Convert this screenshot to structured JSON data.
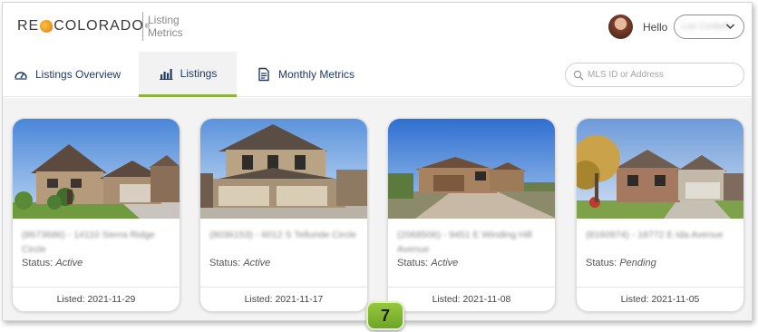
{
  "header": {
    "logo_re": "RE",
    "logo_word": "COLORADO",
    "logo_reg": "®",
    "app_name_line1": "Listing",
    "app_name_line2": "Metrics",
    "greeting": "Hello",
    "user_name": "Lori Corbett",
    "user_select_icon": "chevron-down-icon"
  },
  "nav": {
    "tabs": [
      {
        "label": "Listings Overview",
        "icon": "speedometer-icon",
        "active": false
      },
      {
        "label": "Listings",
        "icon": "bar-chart-icon",
        "active": true
      },
      {
        "label": "Monthly Metrics",
        "icon": "document-icon",
        "active": false
      }
    ],
    "search": {
      "placeholder": "MLS ID or Address",
      "icon": "search-icon"
    }
  },
  "listings": [
    {
      "address": "(8673686) - 14110 Sierra Ridge Circle",
      "status_label": "Status:",
      "status": "Active",
      "listed": "Listed: 2021-11-29"
    },
    {
      "address": "(8036153) - 6012 S Telluride Circle",
      "status_label": "Status:",
      "status": "Active",
      "listed": "Listed: 2021-11-17"
    },
    {
      "address": "(2068506) - 9451 E Winding Hill Avenue",
      "status_label": "Status:",
      "status": "Active",
      "listed": "Listed: 2021-11-08"
    },
    {
      "address": "(8160974) - 18772 E Ida Avenue",
      "status_label": "Status:",
      "status": "Pending",
      "listed": "Listed: 2021-11-05"
    }
  ],
  "step_badge": "7",
  "colors": {
    "brand_orange": "#ee8f1c",
    "nav_text": "#1f3a66",
    "active_tab_underline": "#8bb33a",
    "badge_green": "#7fb532"
  }
}
